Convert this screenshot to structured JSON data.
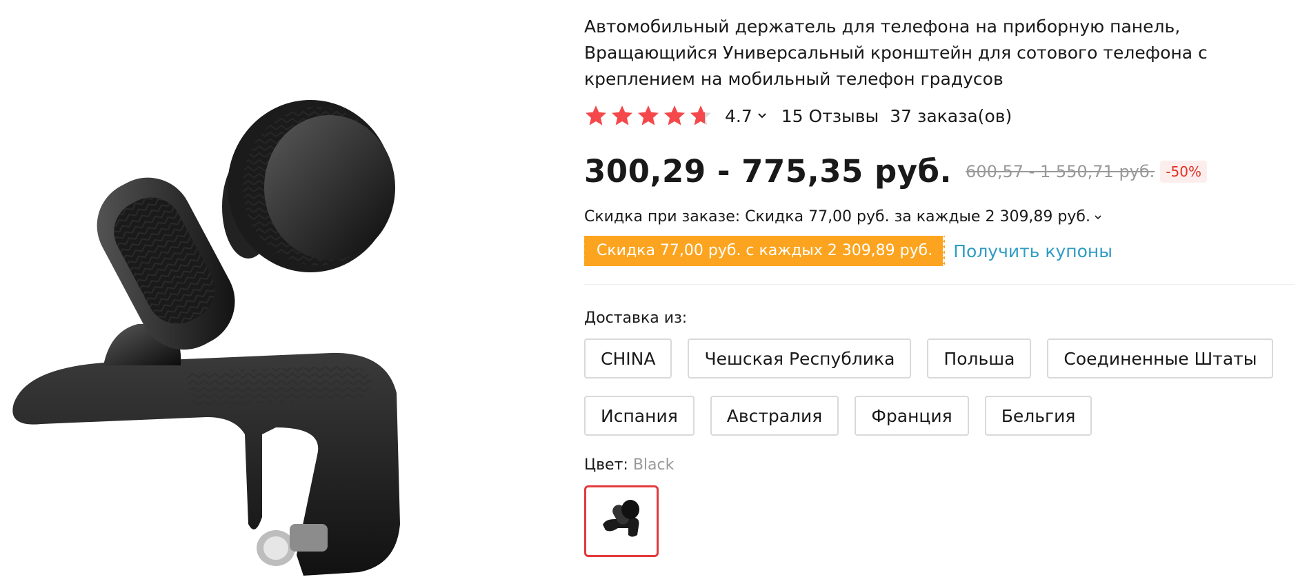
{
  "product": {
    "title": "Автомобильный держатель для телефона на приборную панель, Вращающийся Универсальный кронштейн для сотового телефона с креплением на мобильный телефон градусов",
    "rating": "4.7",
    "reviews": "15 Отзывы",
    "orders": "37 заказа(ов)",
    "rating_fill": 4.7
  },
  "price": {
    "current": "300,29 - 775,35 руб.",
    "original": "600,57 - 1 550,71 руб.",
    "discount": "-50%"
  },
  "promo": {
    "order_discount": "Скидка при заказе: Скидка 77,00 руб. за каждые 2 309,89 руб.",
    "coupon_tag": "Скидка 77,00 руб. с каждых 2 309,89 руб.",
    "get_coupons": "Получить купоны"
  },
  "shipping": {
    "label": "Доставка из:",
    "options": [
      "CHINA",
      "Чешская Республика",
      "Польша",
      "Соединенные Штаты",
      "Испания",
      "Австралия",
      "Франция",
      "Бельгия"
    ]
  },
  "color": {
    "label": "Цвет: ",
    "value": "Black"
  },
  "colors": {
    "star": "#f5484b",
    "star_empty": "#d9d9d9",
    "coupon_bg": "#fca41f",
    "link": "#2e9cc3",
    "selected_border": "#e4393c"
  },
  "icons": {
    "star": "star-icon",
    "caret": "chevron-down-icon"
  }
}
